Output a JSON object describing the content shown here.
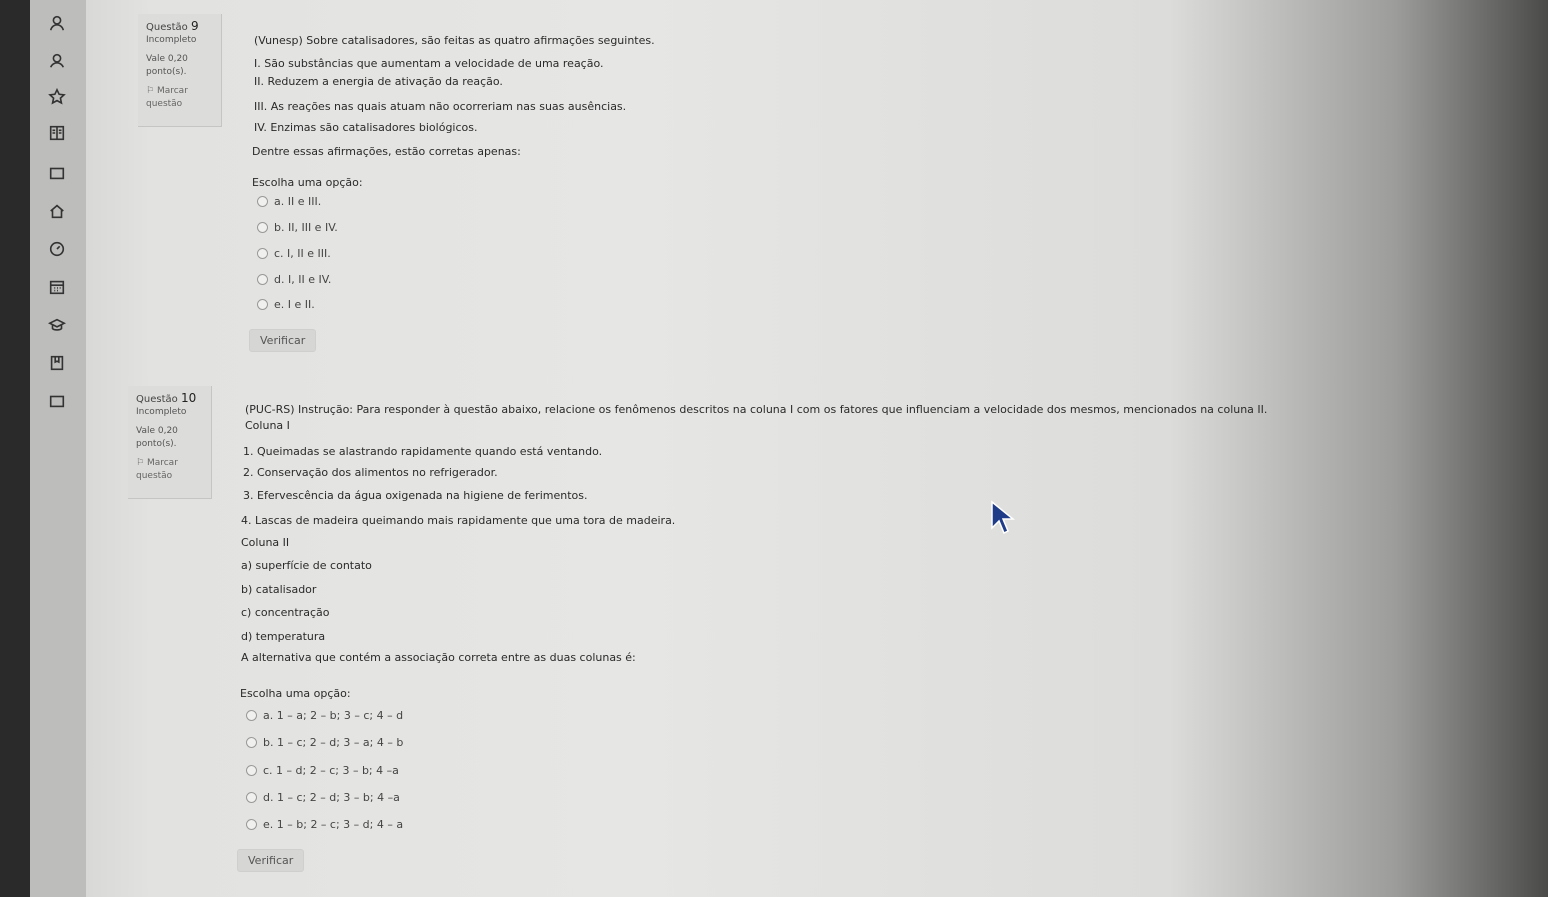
{
  "sidebar": {
    "icons": [
      "profile-icon",
      "users-icon",
      "star-icon",
      "book-icon",
      "folder-icon",
      "home-icon",
      "speedometer-icon",
      "calendar-icon",
      "graduation-cap-icon",
      "bookmark-icon",
      "folder-icon"
    ]
  },
  "q9": {
    "label": "Questão",
    "number": "9",
    "status": "Incompleto",
    "worth": "Vale 0,20",
    "points": "ponto(s).",
    "flag": "Marcar",
    "flag2": "questão",
    "title": "(Vunesp) Sobre catalisadores, são feitas as quatro afirmações seguintes.",
    "lines": [
      "I. São substâncias que aumentam a velocidade de uma reação.",
      "II. Reduzem a energia de ativação da reação.",
      "III. As reações nas quais atuam não ocorreriam nas suas ausências.",
      "IV. Enzimas são catalisadores biológicos.",
      "Dentre essas afirmações, estão corretas apenas:"
    ],
    "prompt": "Escolha uma opção:",
    "options": [
      "a.  II e III.",
      "b.  II, III e IV.",
      "c.  I, II e III.",
      "d.  I, II e IV.",
      "e.  I e II."
    ],
    "verify": "Verificar"
  },
  "q10": {
    "label": "Questão",
    "number": "10",
    "status": "Incompleto",
    "worth": "Vale 0,20",
    "points": "ponto(s).",
    "flag": "Marcar",
    "flag2": "questão",
    "title": "(PUC-RS) Instrução: Para responder à questão abaixo, relacione os fenômenos descritos na coluna I com os fatores que influenciam a velocidade dos mesmos, mencionados na coluna II.",
    "lines": [
      "Coluna I",
      "1. Queimadas se alastrando rapidamente quando está ventando.",
      "2. Conservação dos alimentos no refrigerador.",
      "3. Efervescência da água oxigenada na higiene de ferimentos.",
      "4. Lascas de madeira queimando mais rapidamente que uma tora de madeira.",
      "Coluna II",
      "a) superfície de contato",
      "b) catalisador",
      "c) concentração",
      "d) temperatura",
      "A alternativa que contém a associação correta entre as duas colunas é:"
    ],
    "prompt": "Escolha uma opção:",
    "options": [
      "a.  1 – a; 2 – b; 3 – c; 4 – d",
      "b.  1 – c; 2 – d; 3 – a; 4 – b",
      "c.  1 – d; 2 – c; 3 – b; 4 –a",
      "d.  1 – c; 2 – d; 3 – b; 4 –a",
      "e.  1 – b; 2 – c; 3 – d; 4 – a"
    ],
    "verify": "Verificar"
  }
}
